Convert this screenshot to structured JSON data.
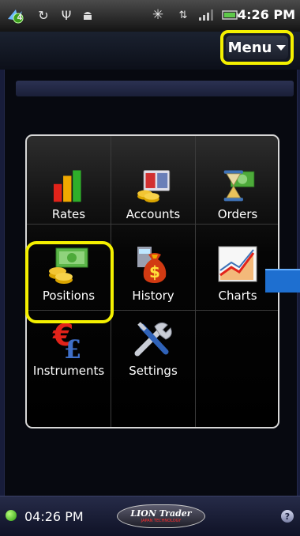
{
  "status_bar": {
    "time": "4:26 PM",
    "notification_count": "4",
    "icons": [
      "notification-badge-icon",
      "sync-icon",
      "usb-icon",
      "android-debug-icon",
      "bluetooth-icon",
      "data-transfer-icon",
      "signal-icon",
      "battery-icon"
    ]
  },
  "header": {
    "menu_label": "Menu"
  },
  "grid": {
    "items": [
      {
        "label": "Rates",
        "icon": "bar-chart-icon"
      },
      {
        "label": "Accounts",
        "icon": "accounts-ledger-icon"
      },
      {
        "label": "Orders",
        "icon": "hourglass-money-icon"
      },
      {
        "label": "Positions",
        "icon": "money-coins-icon"
      },
      {
        "label": "History",
        "icon": "money-bag-icon"
      },
      {
        "label": "Charts",
        "icon": "line-chart-icon"
      },
      {
        "label": "Instruments",
        "icon": "currency-symbols-icon"
      },
      {
        "label": "Settings",
        "icon": "tools-icon"
      }
    ]
  },
  "footer": {
    "time": "04:26 PM",
    "logo_text": "LION Trader",
    "logo_subtext": "JAPAN TECHNOLOGY"
  },
  "colors": {
    "highlight": "#f4f000",
    "background": "#070910",
    "frame": "#171c3a"
  }
}
